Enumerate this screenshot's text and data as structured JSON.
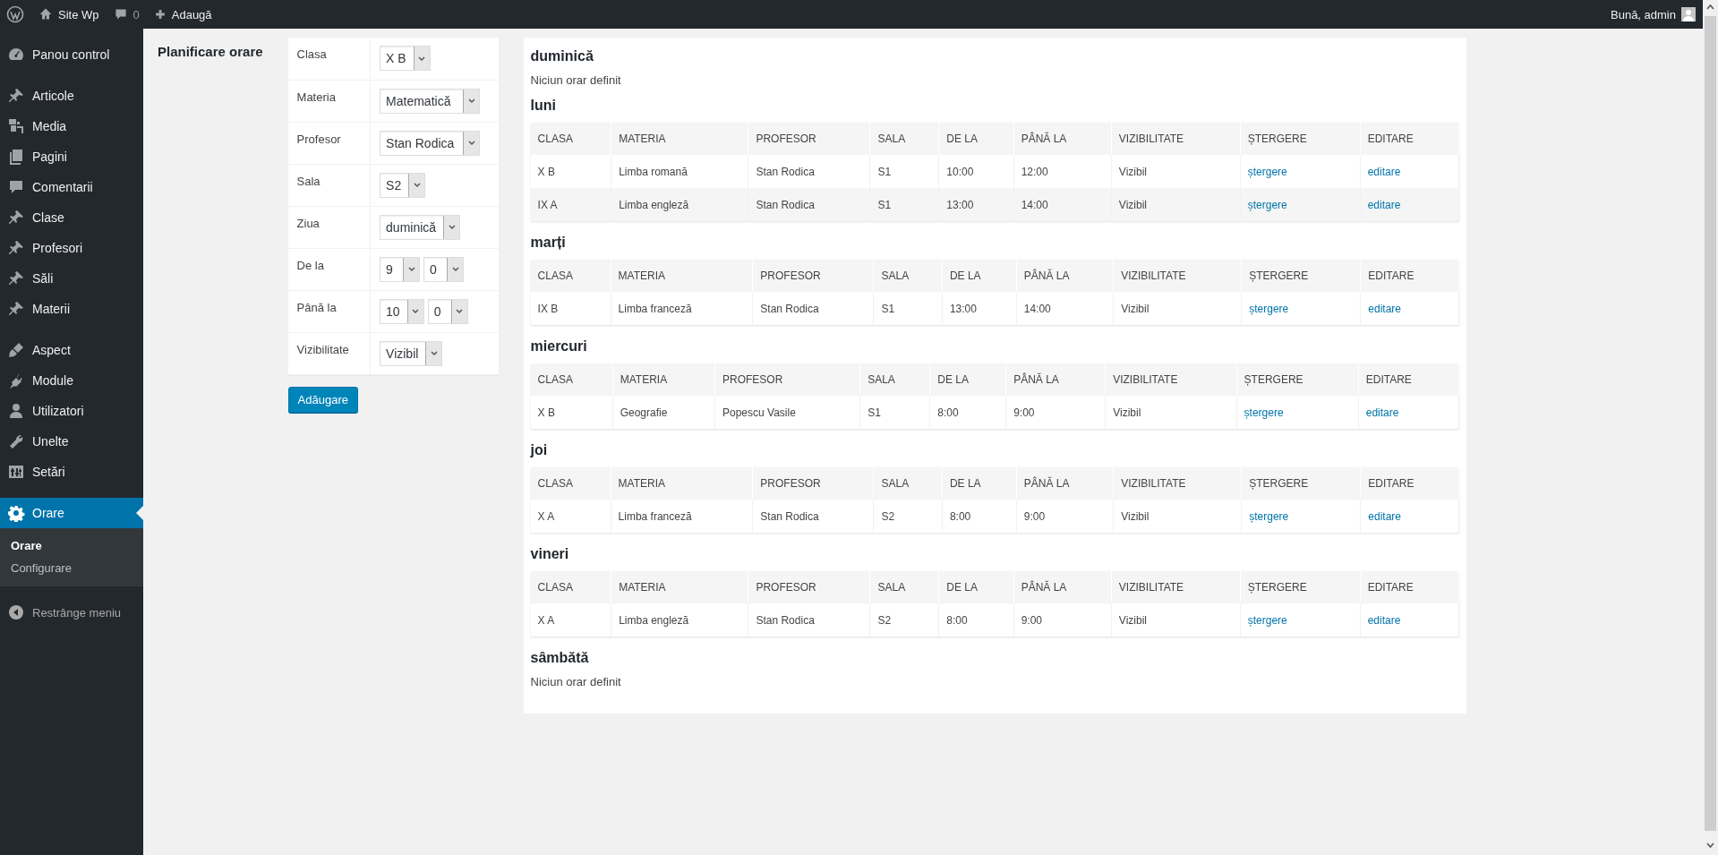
{
  "admin_bar": {
    "site_name": "Site Wp",
    "comments_count": "0",
    "new_label": "Adaugă",
    "greeting": "Bună, admin"
  },
  "sidebar": {
    "groups": [
      [
        {
          "label": "Panou control",
          "selected": false
        }
      ],
      [
        {
          "label": "Articole",
          "selected": false
        },
        {
          "label": "Media",
          "selected": false
        },
        {
          "label": "Pagini",
          "selected": false
        },
        {
          "label": "Comentarii",
          "selected": false
        },
        {
          "label": "Clase",
          "selected": false
        },
        {
          "label": "Profesori",
          "selected": false
        },
        {
          "label": "Săli",
          "selected": false
        },
        {
          "label": "Materii",
          "selected": false
        }
      ],
      [
        {
          "label": "Aspect",
          "selected": false
        },
        {
          "label": "Module",
          "selected": false
        },
        {
          "label": "Utilizatori",
          "selected": false
        },
        {
          "label": "Unelte",
          "selected": false
        },
        {
          "label": "Setări",
          "selected": false
        }
      ],
      [
        {
          "label": "Orare",
          "selected": true,
          "children": [
            {
              "label": "Orare",
              "selected": true
            },
            {
              "label": "Configurare",
              "selected": false
            }
          ]
        }
      ]
    ],
    "collapse_label": "Restrânge meniu"
  },
  "form": {
    "title": "Planificare orare",
    "fields": [
      {
        "label": "Clasa",
        "selects": [
          "X B"
        ]
      },
      {
        "label": "Materia",
        "selects": [
          "Matematică"
        ]
      },
      {
        "label": "Profesor",
        "selects": [
          "Stan Rodica"
        ]
      },
      {
        "label": "Sala",
        "selects": [
          "S2"
        ]
      },
      {
        "label": "Ziua",
        "selects": [
          "duminică"
        ]
      },
      {
        "label": "De la",
        "selects": [
          "9",
          "0"
        ]
      },
      {
        "label": "Până la",
        "selects": [
          "10",
          "0"
        ]
      },
      {
        "label": "Vizibilitate",
        "selects": [
          "Vizibil"
        ]
      }
    ],
    "button": "Adăugare"
  },
  "schedule": {
    "days": [
      {
        "name": "duminică",
        "empty_text": "Niciun orar definit"
      },
      {
        "name": "luni",
        "table": {
          "columns": [
            {
              "label": "CLASA",
              "kind": "text"
            },
            {
              "label": "MATERIA",
              "kind": "text"
            },
            {
              "label": "PROFESOR",
              "kind": "text"
            },
            {
              "label": "SALA",
              "kind": "text"
            },
            {
              "label": "DE LA",
              "kind": "text"
            },
            {
              "label": "PÂNĂ LA",
              "kind": "text"
            },
            {
              "label": "VIZIBILITATE",
              "kind": "text"
            },
            {
              "label": "ȘTERGERE",
              "kind": "link"
            },
            {
              "label": "EDITARE",
              "kind": "link"
            }
          ],
          "rows": [
            [
              "X B",
              "Limba romană",
              "Stan Rodica",
              "S1",
              "10:00",
              "12:00",
              "Vizibil",
              "ștergere",
              "editare"
            ],
            [
              "IX A",
              "Limba engleză",
              "Stan Rodica",
              "S1",
              "13:00",
              "14:00",
              "Vizibil",
              "ștergere",
              "editare"
            ]
          ]
        }
      },
      {
        "name": "marți",
        "table": {
          "columns": [
            {
              "label": "CLASA",
              "kind": "text"
            },
            {
              "label": "MATERIA",
              "kind": "text"
            },
            {
              "label": "PROFESOR",
              "kind": "text"
            },
            {
              "label": "SALA",
              "kind": "text"
            },
            {
              "label": "DE LA",
              "kind": "text"
            },
            {
              "label": "PÂNĂ LA",
              "kind": "text"
            },
            {
              "label": "VIZIBILITATE",
              "kind": "text"
            },
            {
              "label": "ȘTERGERE",
              "kind": "link"
            },
            {
              "label": "EDITARE",
              "kind": "link"
            }
          ],
          "rows": [
            [
              "IX B",
              "Limba franceză",
              "Stan Rodica",
              "S1",
              "13:00",
              "14:00",
              "Vizibil",
              "ștergere",
              "editare"
            ]
          ]
        }
      },
      {
        "name": "miercuri",
        "table": {
          "columns": [
            {
              "label": "CLASA",
              "kind": "text"
            },
            {
              "label": "MATERIA",
              "kind": "text"
            },
            {
              "label": "PROFESOR",
              "kind": "text"
            },
            {
              "label": "SALA",
              "kind": "text"
            },
            {
              "label": "DE LA",
              "kind": "text"
            },
            {
              "label": "PÂNĂ LA",
              "kind": "text"
            },
            {
              "label": "VIZIBILITATE",
              "kind": "text"
            },
            {
              "label": "ȘTERGERE",
              "kind": "link"
            },
            {
              "label": "EDITARE",
              "kind": "link"
            }
          ],
          "rows": [
            [
              "X B",
              "Geografie",
              "Popescu Vasile",
              "S1",
              "8:00",
              "9:00",
              "Vizibil",
              "ștergere",
              "editare"
            ]
          ]
        }
      },
      {
        "name": "joi",
        "table": {
          "columns": [
            {
              "label": "CLASA",
              "kind": "text"
            },
            {
              "label": "MATERIA",
              "kind": "text"
            },
            {
              "label": "PROFESOR",
              "kind": "text"
            },
            {
              "label": "SALA",
              "kind": "text"
            },
            {
              "label": "DE LA",
              "kind": "text"
            },
            {
              "label": "PÂNĂ LA",
              "kind": "text"
            },
            {
              "label": "VIZIBILITATE",
              "kind": "text"
            },
            {
              "label": "ȘTERGERE",
              "kind": "link"
            },
            {
              "label": "EDITARE",
              "kind": "link"
            }
          ],
          "rows": [
            [
              "X A",
              "Limba franceză",
              "Stan Rodica",
              "S2",
              "8:00",
              "9:00",
              "Vizibil",
              "ștergere",
              "editare"
            ]
          ]
        }
      },
      {
        "name": "vineri",
        "table": {
          "columns": [
            {
              "label": "CLASA",
              "kind": "text"
            },
            {
              "label": "MATERIA",
              "kind": "text"
            },
            {
              "label": "PROFESOR",
              "kind": "text"
            },
            {
              "label": "SALA",
              "kind": "text"
            },
            {
              "label": "DE LA",
              "kind": "text"
            },
            {
              "label": "PÂNĂ LA",
              "kind": "text"
            },
            {
              "label": "VIZIBILITATE",
              "kind": "text"
            },
            {
              "label": "ȘTERGERE",
              "kind": "link"
            },
            {
              "label": "EDITARE",
              "kind": "link"
            }
          ],
          "rows": [
            [
              "X A",
              "Limba engleză",
              "Stan Rodica",
              "S2",
              "8:00",
              "9:00",
              "Vizibil",
              "ștergere",
              "editare"
            ]
          ]
        }
      },
      {
        "name": "sâmbătă",
        "empty_text": "Niciun orar definit"
      }
    ]
  }
}
